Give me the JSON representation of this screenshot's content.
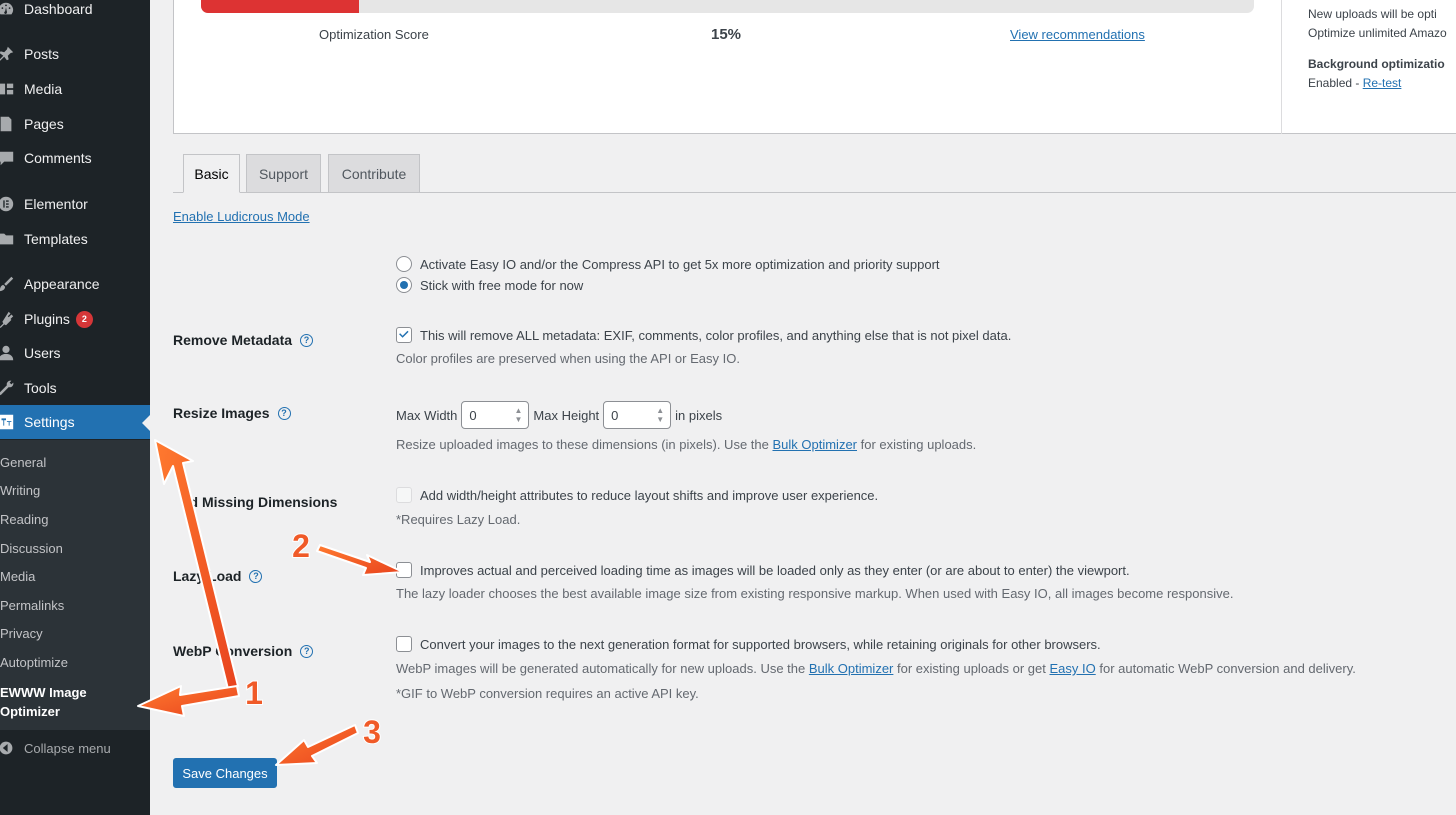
{
  "sidebar": {
    "items": [
      {
        "label": "Dashboard",
        "icon": "dashboard-icon"
      },
      {
        "label": "Posts",
        "icon": "pin-icon"
      },
      {
        "label": "Media",
        "icon": "media-icon"
      },
      {
        "label": "Pages",
        "icon": "pages-icon"
      },
      {
        "label": "Comments",
        "icon": "comment-icon"
      },
      {
        "label": "Elementor",
        "icon": "elementor-icon"
      },
      {
        "label": "Templates",
        "icon": "folder-icon"
      },
      {
        "label": "Appearance",
        "icon": "brush-icon"
      },
      {
        "label": "Plugins",
        "icon": "plugin-icon",
        "badge": "2"
      },
      {
        "label": "Users",
        "icon": "user-icon"
      },
      {
        "label": "Tools",
        "icon": "wrench-icon"
      },
      {
        "label": "Settings",
        "icon": "settings-icon",
        "active": true
      }
    ],
    "submenu": [
      "General",
      "Writing",
      "Reading",
      "Discussion",
      "Media",
      "Permalinks",
      "Privacy",
      "Autoptimize",
      "EWWW Image Optimizer"
    ],
    "collapse_label": "Collapse menu"
  },
  "score": {
    "label": "Optimization Score",
    "value": "15%",
    "progress": 0.15,
    "link": "View recommendations",
    "color": "#dd3333"
  },
  "side_info": {
    "line1": "New uploads will be opti",
    "line2": "Optimize unlimited Amazo",
    "bg_title": "Background optimizatio",
    "bg_status": "Enabled - ",
    "retest": "Re-test"
  },
  "tabs": [
    "Basic",
    "Support",
    "Contribute"
  ],
  "ludicrous_link": "Enable Ludicrous Mode",
  "mode": {
    "option1": "Activate Easy IO and/or the Compress API to get 5x more optimization and priority support",
    "option2": "Stick with free mode for now"
  },
  "remove_metadata": {
    "label": "Remove Metadata",
    "text": "This will remove ALL metadata: EXIF, comments, color profiles, and anything else that is not pixel data.",
    "desc": "Color profiles are preserved when using the API or Easy IO."
  },
  "resize": {
    "label": "Resize Images",
    "width_label": "Max Width",
    "width_value": "0",
    "height_label": "Max Height",
    "height_value": "0",
    "unit": "in pixels",
    "desc_pre": "Resize uploaded images to these dimensions (in pixels). Use the ",
    "desc_link": "Bulk Optimizer",
    "desc_post": " for existing uploads."
  },
  "dimensions": {
    "label": "dd Missing Dimensions",
    "text": "Add width/height attributes to reduce layout shifts and improve user experience.",
    "desc": "*Requires Lazy Load."
  },
  "lazy": {
    "label": "Lazy Load",
    "text": "Improves actual and perceived loading time as images will be loaded only as they enter (or are about to enter) the viewport.",
    "desc": "The lazy loader chooses the best available image size from existing responsive markup. When used with Easy IO, all images become responsive."
  },
  "webp": {
    "label": "WebP Conversion",
    "text": "Convert your images to the next generation format for supported browsers, while retaining originals for other browsers.",
    "desc_pre": "WebP images will be generated automatically for new uploads. Use the ",
    "desc_link1": "Bulk Optimizer",
    "desc_mid": " for existing uploads or get ",
    "desc_link2": "Easy IO",
    "desc_post": " for automatic WebP conversion and delivery.",
    "note": "*GIF to WebP conversion requires an active API key."
  },
  "save_label": "Save Changes",
  "annotations": {
    "step1": "1",
    "step2": "2",
    "step3": "3",
    "color": "#f05a28"
  }
}
